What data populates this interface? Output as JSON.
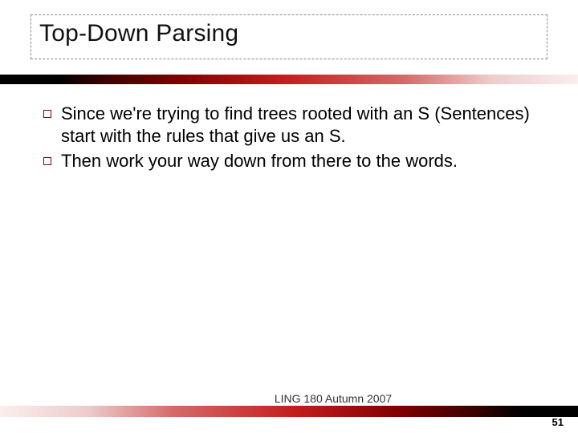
{
  "title": "Top-Down Parsing",
  "bullets": [
    "Since we're trying to find trees rooted with an S (Sentences) start with the rules that give us an S.",
    "Then work your way down from there to the words."
  ],
  "footer": "LING 180 Autumn 2007",
  "page_number": "51"
}
